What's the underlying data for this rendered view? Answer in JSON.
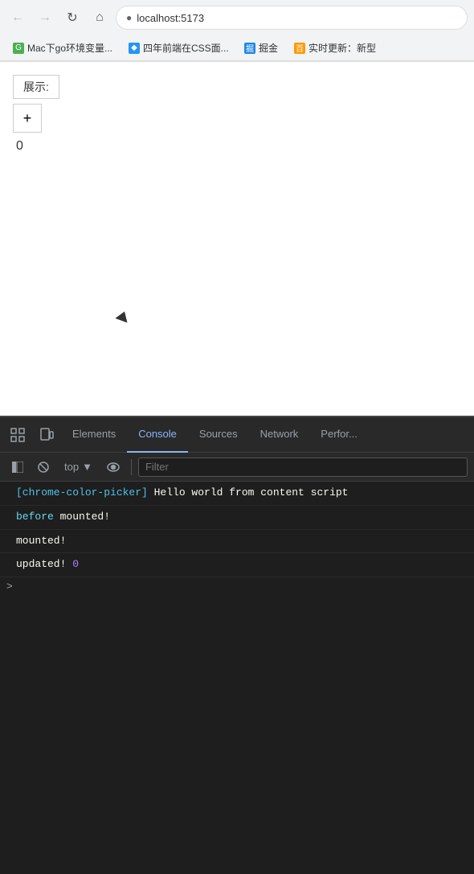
{
  "browser": {
    "url": "localhost:5173",
    "back_disabled": true,
    "forward_disabled": true
  },
  "bookmarks": [
    {
      "id": "bm1",
      "label": "Mac下go环境变量...",
      "color": "#4caf50"
    },
    {
      "id": "bm2",
      "label": "四年前端在CSS面...",
      "color": "#2196f3"
    },
    {
      "id": "bm3",
      "label": "掘金",
      "color": "#2196f3"
    },
    {
      "id": "bm4",
      "label": "实时更新：新型",
      "color": "#ff9800"
    }
  ],
  "page": {
    "demo_label": "展示:",
    "plus_button": "+",
    "counter": "0"
  },
  "devtools": {
    "tabs": [
      {
        "id": "elements",
        "label": "Elements",
        "active": false
      },
      {
        "id": "console",
        "label": "Console",
        "active": true
      },
      {
        "id": "sources",
        "label": "Sources",
        "active": false
      },
      {
        "id": "network",
        "label": "Network",
        "active": false
      },
      {
        "id": "performance",
        "label": "Perfor...",
        "active": false
      }
    ],
    "toolbar": {
      "top_label": "top",
      "filter_placeholder": "Filter"
    },
    "console_lines": [
      {
        "id": "line1",
        "parts": [
          {
            "text": "[chrome-color-picker]",
            "class": "cl-blue"
          },
          {
            "text": " Hello world from content script",
            "class": "cl-white"
          }
        ]
      },
      {
        "id": "line2",
        "parts": [
          {
            "text": "before",
            "class": "cl-cyan"
          },
          {
            "text": " mounted!",
            "class": "cl-white"
          }
        ]
      },
      {
        "id": "line3",
        "parts": [
          {
            "text": "mounted!",
            "class": "cl-white"
          }
        ]
      },
      {
        "id": "line4",
        "parts": [
          {
            "text": "updated!",
            "class": "cl-white"
          },
          {
            "text": " 0",
            "class": "cl-number"
          }
        ]
      }
    ]
  }
}
